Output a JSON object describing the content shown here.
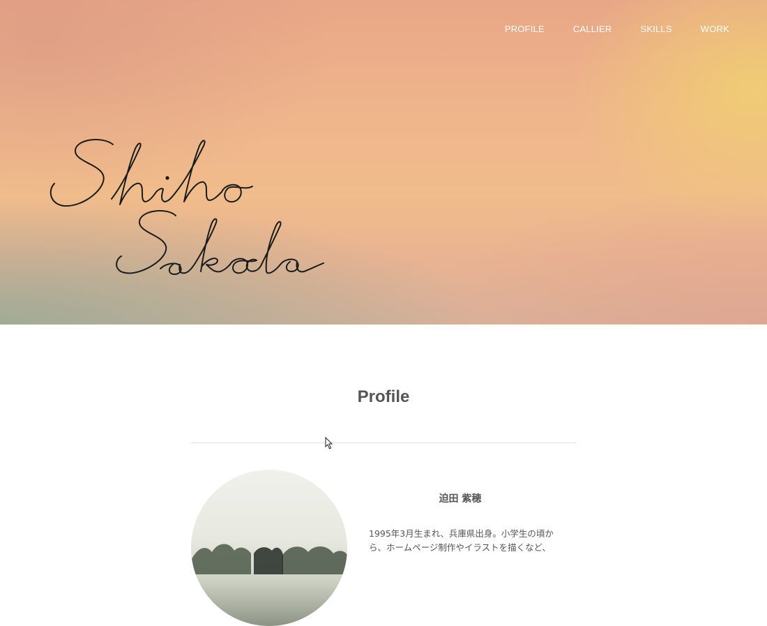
{
  "nav": {
    "items": [
      "PROFILE",
      "CALLIER",
      "SKILLS",
      "WORK"
    ]
  },
  "hero": {
    "signature_text": "Shiho Sakoda"
  },
  "profile": {
    "title": "Profile",
    "name": "迫田 紫穂",
    "bio_line1": "1995年3月生まれ、兵庫県出身。小学生の頃か",
    "bio_line2": "ら、ホームページ制作やイラストを描くなど、"
  },
  "colors": {
    "text": "#555555",
    "nav_text": "#ffffff",
    "divider": "#dddddd",
    "hero_top": "#e8a787",
    "hero_highlight": "#f0cd73"
  },
  "icons": {
    "cursor": "mouse-pointer-icon"
  }
}
